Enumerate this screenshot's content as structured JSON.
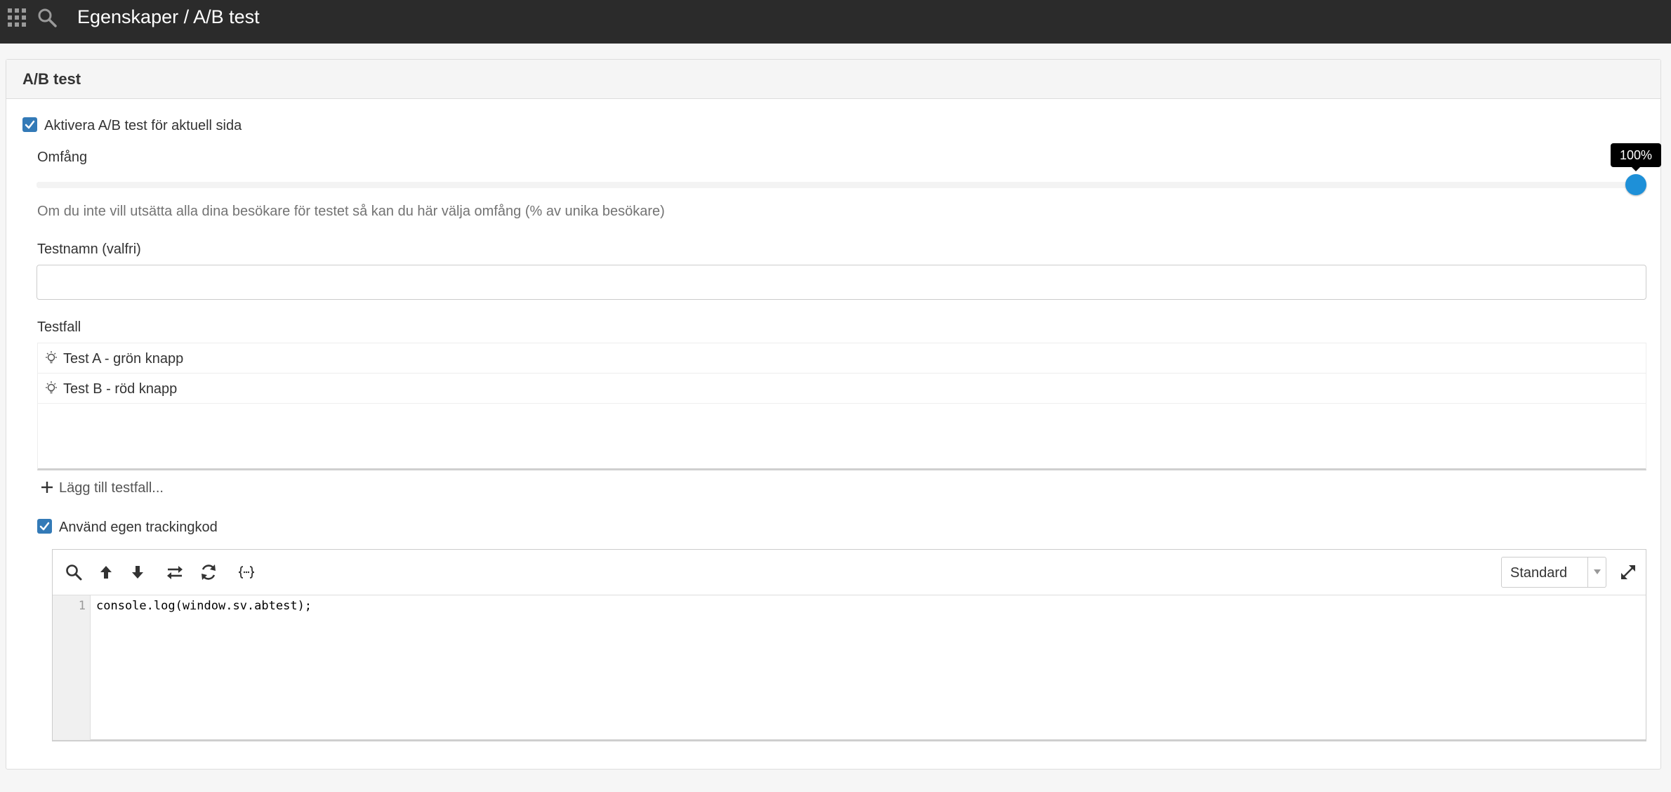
{
  "header": {
    "title": "Egenskaper / A/B test"
  },
  "panel": {
    "title": "A/B test"
  },
  "abtest": {
    "enable_label": "Aktivera A/B test för aktuell sida",
    "enabled": true
  },
  "scope": {
    "label": "Omfång",
    "value_percent": 100,
    "tooltip": "100%",
    "help": "Om du inte vill utsätta alla dina besökare för testet så kan du här välja omfång (% av unika besökare)"
  },
  "testname": {
    "label": "Testnamn (valfri)",
    "value": "",
    "placeholder": ""
  },
  "testcases": {
    "label": "Testfall",
    "items": [
      {
        "label": "Test A - grön knapp",
        "icon": "lightbulb-icon"
      },
      {
        "label": "Test B - röd knapp",
        "icon": "lightbulb-icon"
      }
    ],
    "add_label": "Lägg till testfall..."
  },
  "tracking": {
    "label": "Använd egen trackingkod",
    "enabled": true
  },
  "editor": {
    "toolbar": [
      {
        "name": "search-icon"
      },
      {
        "name": "arrow-up-icon"
      },
      {
        "name": "arrow-down-icon"
      },
      {
        "name": "swap-icon"
      },
      {
        "name": "refresh-icon"
      },
      {
        "name": "braces-icon"
      }
    ],
    "mode": "Standard",
    "lines": [
      {
        "number": "1",
        "text": "console.log(window.sv.abtest);"
      }
    ]
  },
  "colors": {
    "topbar": "#2b2b2b",
    "accent": "#337ab7",
    "slider_handle": "#1e90d8"
  }
}
